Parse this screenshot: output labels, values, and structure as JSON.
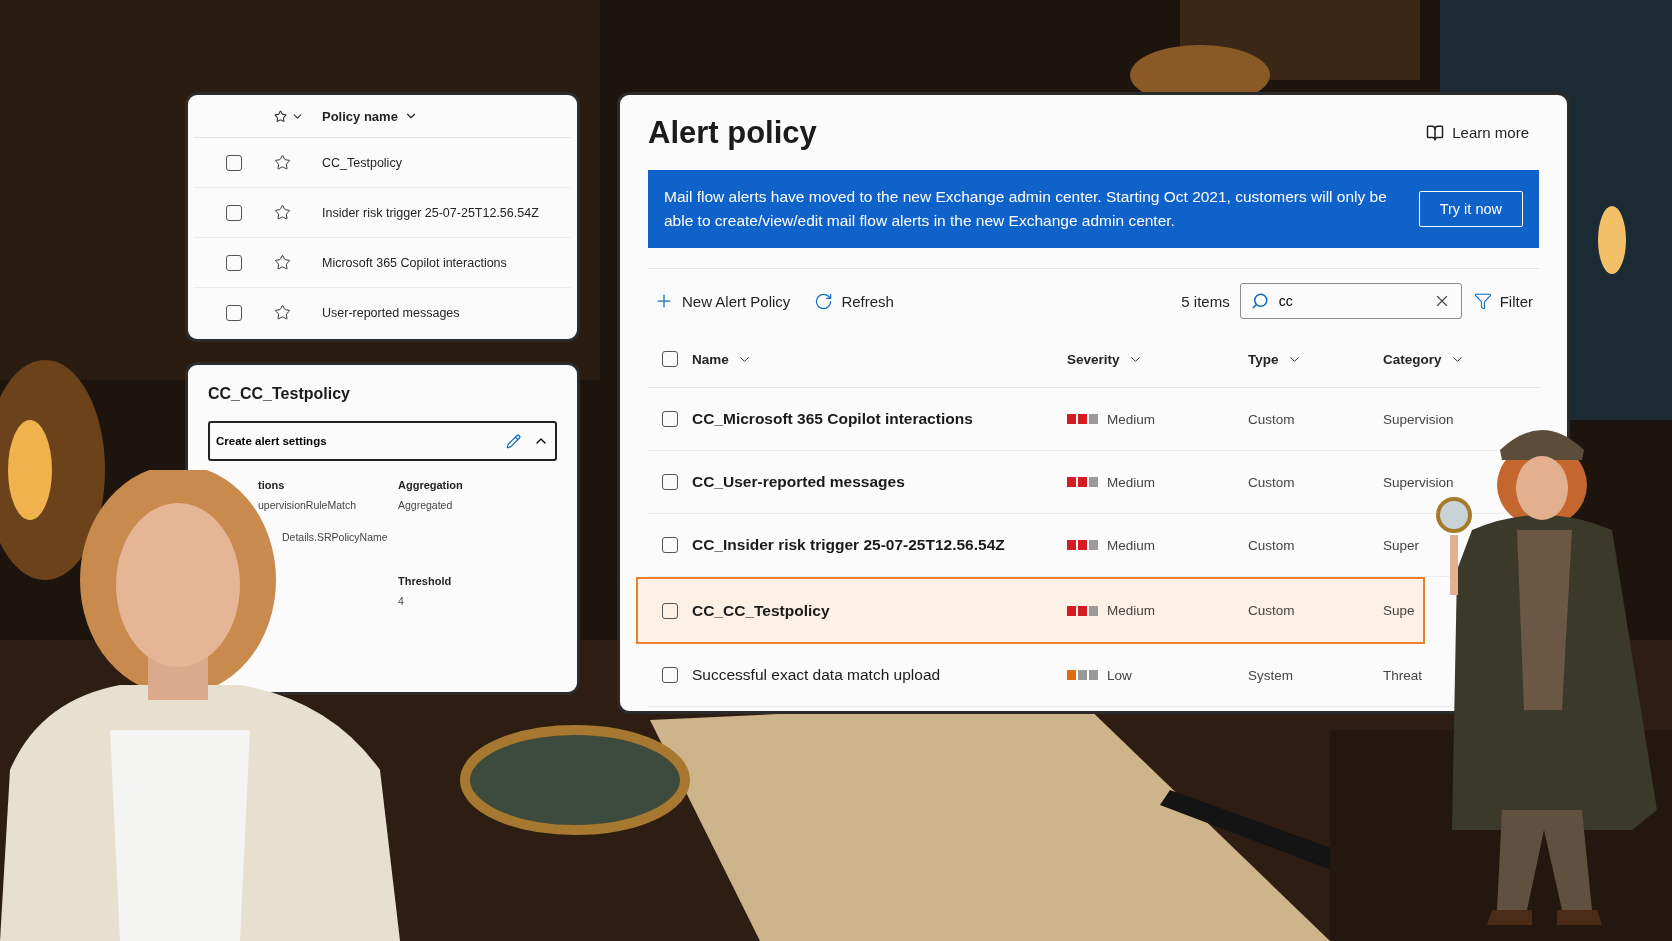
{
  "policy_list": {
    "header": {
      "policy_name": "Policy name"
    },
    "rows": [
      {
        "name": "CC_Testpolicy",
        "checked": false,
        "starred": false
      },
      {
        "name": "Insider risk trigger 25-07-25T12.56.54Z",
        "checked": false,
        "starred": false
      },
      {
        "name": "Microsoft 365 Copilot interactions",
        "checked": false,
        "starred": false
      },
      {
        "name": "User-reported messages",
        "checked": false,
        "starred": false
      }
    ]
  },
  "policy_details": {
    "title": "CC_CC_Testpolicy",
    "section": {
      "title": "Create alert settings",
      "expanded": true
    },
    "fields_left": [
      {
        "kind": "label",
        "text": "tions"
      },
      {
        "kind": "value",
        "text": "upervisionRuleMatch"
      },
      {
        "kind": "value",
        "text": "Details.SRPolicyName"
      }
    ],
    "fields_right": [
      {
        "label": "Aggregation",
        "value": "Aggregated"
      },
      {
        "label": "Threshold",
        "value": "4"
      }
    ]
  },
  "alert_policy": {
    "title": "Alert policy",
    "learn_more": "Learn more",
    "banner": {
      "text": "Mail flow alerts have moved to the new Exchange admin center. Starting Oct 2021, customers will only be able to create/view/edit mail flow alerts in the new Exchange admin center.",
      "button": "Try it now"
    },
    "toolbar": {
      "new": "New Alert Policy",
      "refresh": "Refresh",
      "count": "5 items",
      "search": {
        "value": "cc"
      },
      "filter": "Filter"
    },
    "select_all": {
      "checked": false
    },
    "columns": [
      "Name",
      "Severity",
      "Type",
      "Category"
    ],
    "rows": [
      {
        "name": "CC_Microsoft 365 Copilot interactions",
        "severity": {
          "text": "Medium",
          "kind": "medium"
        },
        "type": "Custom",
        "category": "Supervision",
        "checked": false,
        "selected": false,
        "bold": true
      },
      {
        "name": "CC_User-reported messages",
        "severity": {
          "text": "Medium",
          "kind": "medium"
        },
        "type": "Custom",
        "category": "Supervision",
        "checked": false,
        "selected": false,
        "bold": true
      },
      {
        "name": "CC_Insider risk trigger 25-07-25T12.56.54Z",
        "severity": {
          "text": "Medium",
          "kind": "medium"
        },
        "type": "Custom",
        "category": "Super",
        "checked": false,
        "selected": false,
        "bold": true
      },
      {
        "name": "CC_CC_Testpolicy",
        "severity": {
          "text": "Medium",
          "kind": "medium"
        },
        "type": "Custom",
        "category": "Supe",
        "checked": false,
        "selected": true,
        "bold": true
      },
      {
        "name": "Successful exact data match upload",
        "severity": {
          "text": "Low",
          "kind": "low"
        },
        "type": "System",
        "category": "Threat",
        "checked": false,
        "selected": false,
        "bold": false
      }
    ]
  }
}
